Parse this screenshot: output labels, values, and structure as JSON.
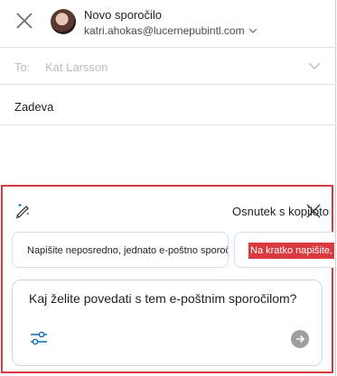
{
  "header": {
    "title": "Novo sporočilo",
    "account": "katri.ahokas@lucernepubintl.com"
  },
  "to": {
    "label": "To:",
    "value": "Kat Larsson"
  },
  "subject": {
    "label": "Zadeva"
  },
  "copilot": {
    "title": "Osnutek s kopilotom",
    "chips": [
      "Napišite neposredno, jednato e-poštno sporočilo",
      "Na kratko napišite,"
    ],
    "prompt": "Kaj želite povedati s tem e-poštnim sporočilom?"
  },
  "colors": {
    "highlight": "#d83a3f",
    "accent_blue": "#0f6cbd"
  },
  "icons": [
    "close-icon",
    "avatar",
    "chevron-down-icon",
    "copilot-pen-icon",
    "settings-sliders-icon",
    "send-arrow-icon"
  ]
}
